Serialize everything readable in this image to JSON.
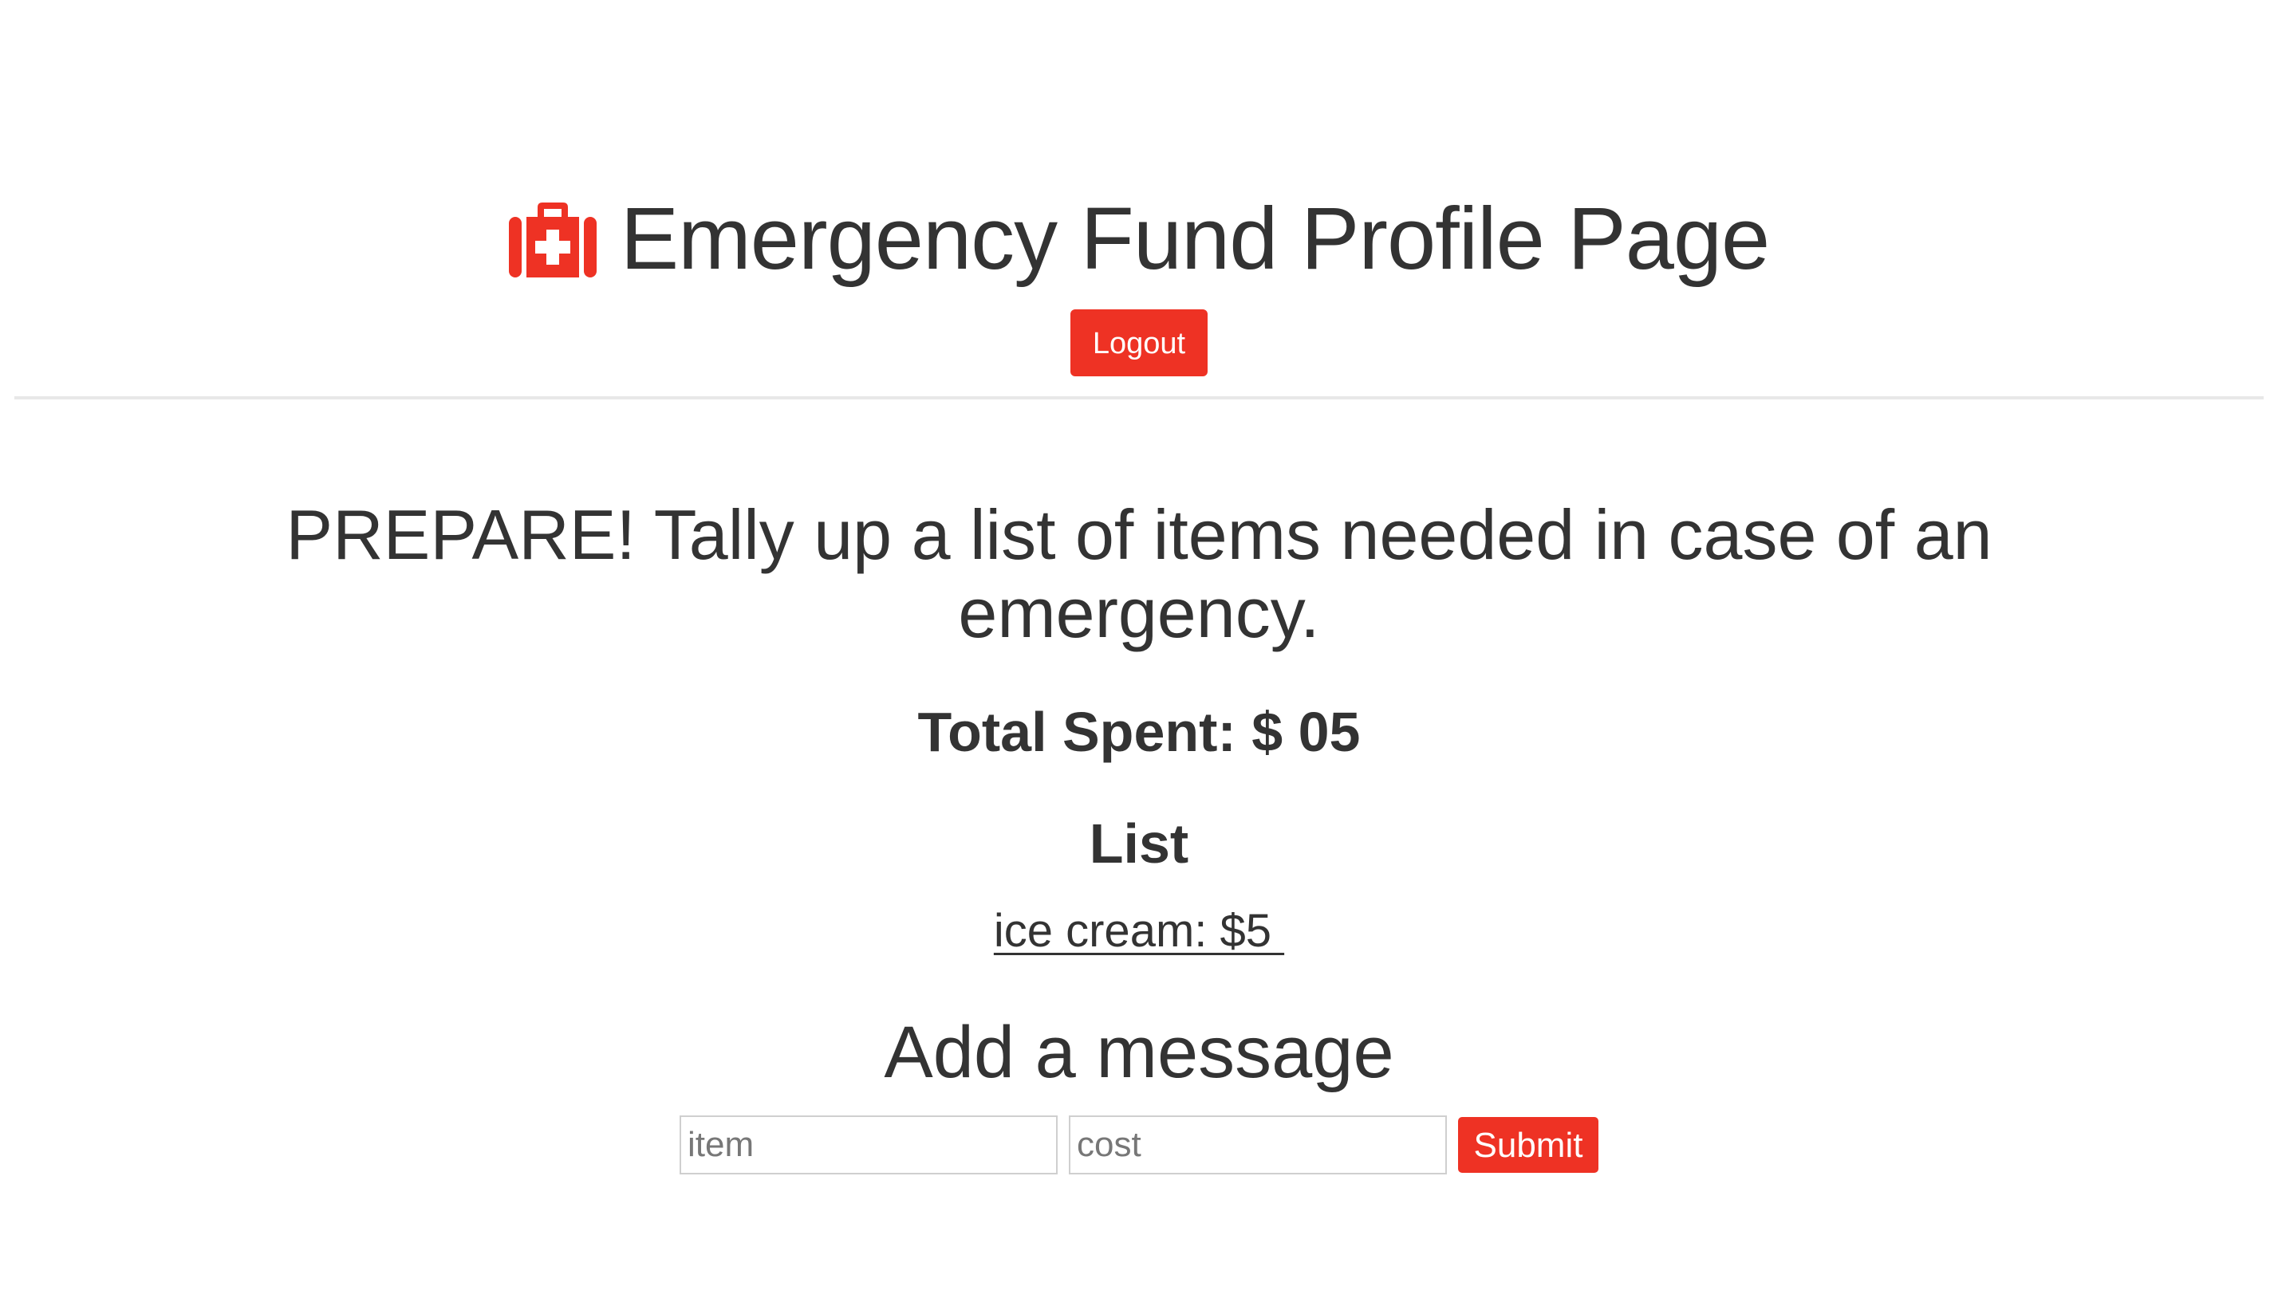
{
  "header": {
    "title": "Emergency Fund Profile Page",
    "title_icon": "medkit-icon",
    "logout_label": "Logout"
  },
  "main": {
    "intro": "PREPARE! Tally up a list of items needed in case of an emergency.",
    "total_label": "Total Spent: $ 05",
    "list_heading": "List",
    "items": [
      {
        "text": "ice cream: $5 "
      }
    ],
    "add_heading": "Add a message"
  },
  "form": {
    "item_placeholder": "item",
    "cost_placeholder": "cost",
    "submit_label": "Submit"
  },
  "colors": {
    "accent": "#ee3224",
    "text": "#333333",
    "divider": "#e8e8e8"
  }
}
